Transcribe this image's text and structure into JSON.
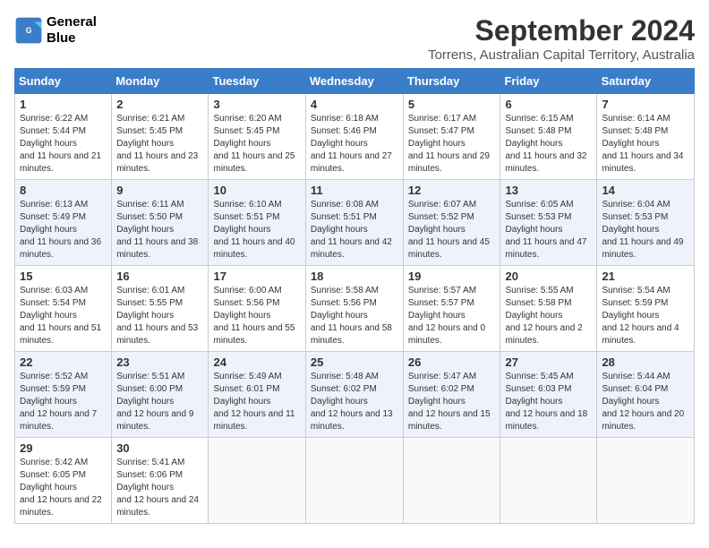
{
  "logo": {
    "line1": "General",
    "line2": "Blue"
  },
  "title": "September 2024",
  "location": "Torrens, Australian Capital Territory, Australia",
  "weekdays": [
    "Sunday",
    "Monday",
    "Tuesday",
    "Wednesday",
    "Thursday",
    "Friday",
    "Saturday"
  ],
  "weeks": [
    [
      {
        "day": "1",
        "sunrise": "6:22 AM",
        "sunset": "5:44 PM",
        "daylight": "11 hours and 21 minutes."
      },
      {
        "day": "2",
        "sunrise": "6:21 AM",
        "sunset": "5:45 PM",
        "daylight": "11 hours and 23 minutes."
      },
      {
        "day": "3",
        "sunrise": "6:20 AM",
        "sunset": "5:45 PM",
        "daylight": "11 hours and 25 minutes."
      },
      {
        "day": "4",
        "sunrise": "6:18 AM",
        "sunset": "5:46 PM",
        "daylight": "11 hours and 27 minutes."
      },
      {
        "day": "5",
        "sunrise": "6:17 AM",
        "sunset": "5:47 PM",
        "daylight": "11 hours and 29 minutes."
      },
      {
        "day": "6",
        "sunrise": "6:15 AM",
        "sunset": "5:48 PM",
        "daylight": "11 hours and 32 minutes."
      },
      {
        "day": "7",
        "sunrise": "6:14 AM",
        "sunset": "5:48 PM",
        "daylight": "11 hours and 34 minutes."
      }
    ],
    [
      {
        "day": "8",
        "sunrise": "6:13 AM",
        "sunset": "5:49 PM",
        "daylight": "11 hours and 36 minutes."
      },
      {
        "day": "9",
        "sunrise": "6:11 AM",
        "sunset": "5:50 PM",
        "daylight": "11 hours and 38 minutes."
      },
      {
        "day": "10",
        "sunrise": "6:10 AM",
        "sunset": "5:51 PM",
        "daylight": "11 hours and 40 minutes."
      },
      {
        "day": "11",
        "sunrise": "6:08 AM",
        "sunset": "5:51 PM",
        "daylight": "11 hours and 42 minutes."
      },
      {
        "day": "12",
        "sunrise": "6:07 AM",
        "sunset": "5:52 PM",
        "daylight": "11 hours and 45 minutes."
      },
      {
        "day": "13",
        "sunrise": "6:05 AM",
        "sunset": "5:53 PM",
        "daylight": "11 hours and 47 minutes."
      },
      {
        "day": "14",
        "sunrise": "6:04 AM",
        "sunset": "5:53 PM",
        "daylight": "11 hours and 49 minutes."
      }
    ],
    [
      {
        "day": "15",
        "sunrise": "6:03 AM",
        "sunset": "5:54 PM",
        "daylight": "11 hours and 51 minutes."
      },
      {
        "day": "16",
        "sunrise": "6:01 AM",
        "sunset": "5:55 PM",
        "daylight": "11 hours and 53 minutes."
      },
      {
        "day": "17",
        "sunrise": "6:00 AM",
        "sunset": "5:56 PM",
        "daylight": "11 hours and 55 minutes."
      },
      {
        "day": "18",
        "sunrise": "5:58 AM",
        "sunset": "5:56 PM",
        "daylight": "11 hours and 58 minutes."
      },
      {
        "day": "19",
        "sunrise": "5:57 AM",
        "sunset": "5:57 PM",
        "daylight": "12 hours and 0 minutes."
      },
      {
        "day": "20",
        "sunrise": "5:55 AM",
        "sunset": "5:58 PM",
        "daylight": "12 hours and 2 minutes."
      },
      {
        "day": "21",
        "sunrise": "5:54 AM",
        "sunset": "5:59 PM",
        "daylight": "12 hours and 4 minutes."
      }
    ],
    [
      {
        "day": "22",
        "sunrise": "5:52 AM",
        "sunset": "5:59 PM",
        "daylight": "12 hours and 7 minutes."
      },
      {
        "day": "23",
        "sunrise": "5:51 AM",
        "sunset": "6:00 PM",
        "daylight": "12 hours and 9 minutes."
      },
      {
        "day": "24",
        "sunrise": "5:49 AM",
        "sunset": "6:01 PM",
        "daylight": "12 hours and 11 minutes."
      },
      {
        "day": "25",
        "sunrise": "5:48 AM",
        "sunset": "6:02 PM",
        "daylight": "12 hours and 13 minutes."
      },
      {
        "day": "26",
        "sunrise": "5:47 AM",
        "sunset": "6:02 PM",
        "daylight": "12 hours and 15 minutes."
      },
      {
        "day": "27",
        "sunrise": "5:45 AM",
        "sunset": "6:03 PM",
        "daylight": "12 hours and 18 minutes."
      },
      {
        "day": "28",
        "sunrise": "5:44 AM",
        "sunset": "6:04 PM",
        "daylight": "12 hours and 20 minutes."
      }
    ],
    [
      {
        "day": "29",
        "sunrise": "5:42 AM",
        "sunset": "6:05 PM",
        "daylight": "12 hours and 22 minutes."
      },
      {
        "day": "30",
        "sunrise": "5:41 AM",
        "sunset": "6:06 PM",
        "daylight": "12 hours and 24 minutes."
      },
      null,
      null,
      null,
      null,
      null
    ]
  ]
}
